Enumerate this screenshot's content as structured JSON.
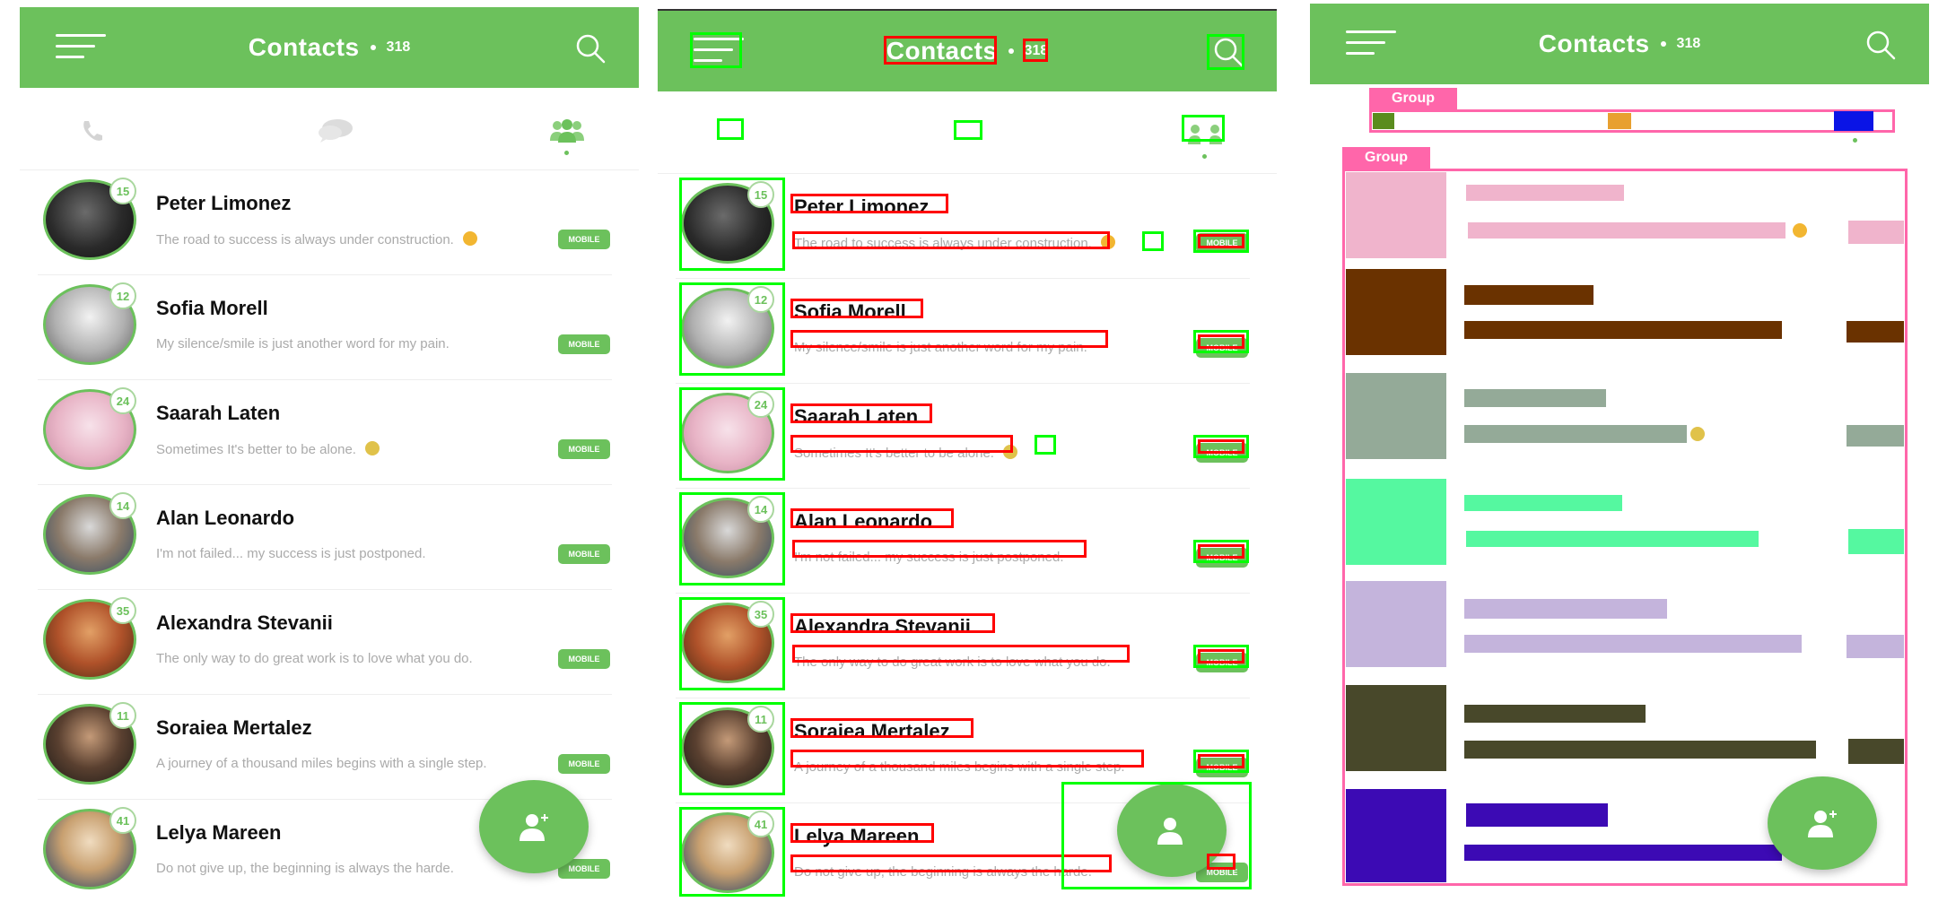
{
  "app": {
    "title": "Contacts",
    "count": "318",
    "accent_color": "#6cc15c"
  },
  "tabs": [
    {
      "icon": "phone-icon"
    },
    {
      "icon": "chat-bubble-icon"
    },
    {
      "icon": "people-icon"
    }
  ],
  "contacts": [
    {
      "name": "Peter Limonez",
      "status": "The road to success is always under construction.",
      "emoji": "happy",
      "badge": "15",
      "tag": "MOBILE"
    },
    {
      "name": "Sofia Morell",
      "status": "My silence/smile is just another word for my pain.",
      "emoji": "",
      "badge": "12",
      "tag": "MOBILE"
    },
    {
      "name": "Saarah Laten",
      "status": "Sometimes It's better to be alone.",
      "emoji": "sad",
      "badge": "24",
      "tag": "MOBILE"
    },
    {
      "name": "Alan Leonardo",
      "status": "I'm not failed... my success is just postponed.",
      "emoji": "",
      "badge": "14",
      "tag": "MOBILE"
    },
    {
      "name": "Alexandra Stevanii",
      "status": "The only way to do great work is to love what you do.",
      "emoji": "",
      "badge": "35",
      "tag": "MOBILE"
    },
    {
      "name": "Soraiea Mertalez",
      "status": "A journey of a thousand miles begins with a single step.",
      "emoji": "",
      "badge": "11",
      "tag": "MOBILE"
    },
    {
      "name": "Lelya Mareen",
      "status": "Do not give up, the beginning is always the harde.",
      "emoji": "",
      "badge": "41",
      "tag": "MOBILE"
    }
  ],
  "fab": {
    "icon": "add-contact-icon"
  },
  "annotation": {
    "group_label": "Group",
    "group_colors": {
      "tab_calls": "#5a8c1e",
      "tab_chats": "#e8a030",
      "tab_contacts": "#0a14e6",
      "rows": [
        "#f0b4cc",
        "#6a3200",
        "#94aa98",
        "#55f8a0",
        "#c4b4dc",
        "#48482a",
        "#3c0ab4"
      ]
    }
  }
}
